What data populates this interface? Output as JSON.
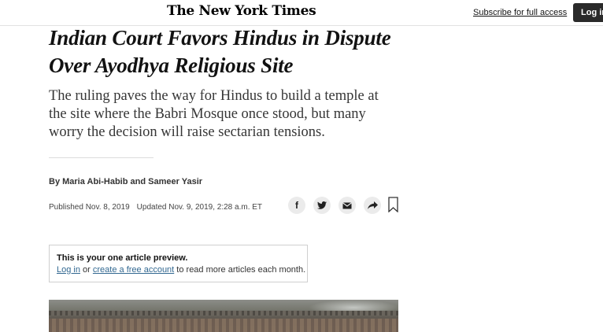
{
  "header": {
    "logo_text": "The New York Times",
    "subscribe_link": "Subscribe for full access",
    "login_button": "Log in"
  },
  "article": {
    "headline": "Indian Court Favors Hindus in Dispute Over Ayodhya Religious Site",
    "summary": "The ruling paves the way for Hindus to build a temple at the site where the Babri Mosque once stood, but many worry the decision will raise sectarian tensions.",
    "byline": {
      "prefix": "By",
      "author1": "Maria Abi-Habib",
      "conjunction": "and",
      "author2": "Sameer Yasir"
    },
    "published": "Published Nov. 8, 2019",
    "updated": "Updated Nov. 9, 2019, 2:28 a.m. ET"
  },
  "share_icons": [
    "facebook-icon",
    "twitter-icon",
    "email-icon",
    "share-arrow-icon",
    "bookmark-icon"
  ],
  "preview_notice": {
    "title": "This is your one article preview.",
    "login_link": "Log in",
    "or_text": "or",
    "create_account_link": "create a free account",
    "suffix": "to read more articles each month."
  },
  "colors": {
    "link_blue": "#326891",
    "login_bg": "#2a2a2a",
    "share_icon_bg": "#ebebeb"
  }
}
